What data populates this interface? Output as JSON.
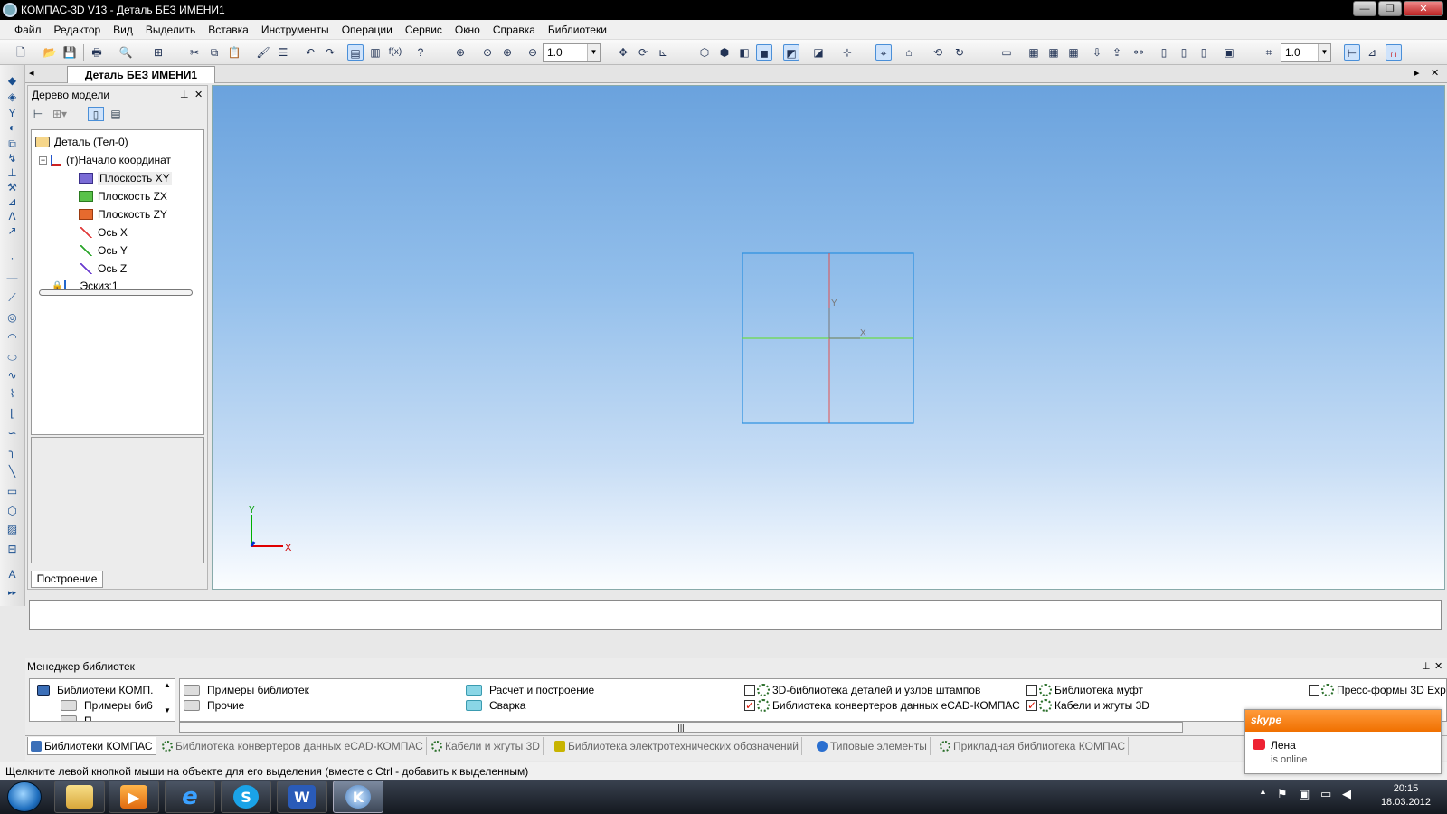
{
  "window": {
    "title": "КОМПАС-3D V13 - Деталь БЕЗ ИМЕНИ1",
    "minimize_icon": "minimize-icon",
    "maximize_icon": "restore-icon",
    "close_icon": "close-icon"
  },
  "menu": [
    "Файл",
    "Редактор",
    "Вид",
    "Выделить",
    "Вставка",
    "Инструменты",
    "Операции",
    "Сервис",
    "Окно",
    "Справка",
    "Библиотеки"
  ],
  "toolbar": {
    "zoom_value": "1.0",
    "step_value": "1.0"
  },
  "document_tab": "Деталь БЕЗ ИМЕНИ1",
  "model_tree": {
    "title": "Дерево модели",
    "items": [
      {
        "label": "Деталь (Тел-0)",
        "icon": "part-icon"
      },
      {
        "label": "(т)Начало координат",
        "icon": "origin-icon"
      },
      {
        "label": "Плоскость XY",
        "icon": "plane-xy-icon"
      },
      {
        "label": "Плоскость ZX",
        "icon": "plane-zx-icon"
      },
      {
        "label": "Плоскость ZY",
        "icon": "plane-zy-icon"
      },
      {
        "label": "Ось X",
        "icon": "axis-x-icon"
      },
      {
        "label": "Ось Y",
        "icon": "axis-y-icon"
      },
      {
        "label": "Ось Z",
        "icon": "axis-z-icon"
      },
      {
        "label": "Эскиз:1",
        "icon": "sketch-icon"
      }
    ],
    "tab_label": "Построение"
  },
  "viewport": {
    "sketch_axis_x": "X",
    "sketch_axis_y": "Y",
    "triad_x": "X",
    "triad_y": "Y",
    "colors": {
      "plane_border": "#2a8fe0",
      "axis_red": "#e05050",
      "axis_green": "#6cd94a",
      "triad_x": "#e00000",
      "triad_y": "#00b000",
      "triad_z": "#0030d0"
    }
  },
  "library_manager": {
    "title": "Менеджер библиотек",
    "left_items": [
      "Библиотеки КОМП.",
      "Примеры би6",
      "П"
    ],
    "items": [
      {
        "label": "Примеры библиотек",
        "icon": "folder-icon"
      },
      {
        "label": "Прочие",
        "icon": "folder-icon"
      },
      {
        "label": "Расчет и построение",
        "icon": "folder-icon"
      },
      {
        "label": "Сварка",
        "icon": "folder-icon"
      },
      {
        "label": "3D-библиотека деталей и узлов штампов",
        "icon": "library-gear-icon",
        "checked": false
      },
      {
        "label": "Библиотека конвертеров данных eCAD-КОМПАС",
        "icon": "library-gear-icon",
        "checked": true
      },
      {
        "label": "Библиотека муфт",
        "icon": "library-gear-icon",
        "checked": false
      },
      {
        "label": "Кабели и жгуты 3D",
        "icon": "library-gear-icon",
        "checked": true
      },
      {
        "label": "Пресс-формы 3D Exp",
        "icon": "library-gear-icon",
        "checked": false
      }
    ],
    "tabs": [
      "Библиотеки КОМПАС",
      "Библиотека конвертеров данных eCAD-КОМПАС",
      "Кабели и жгуты 3D",
      "Библиотека электротехнических обозначений",
      "Типовые элементы",
      "Прикладная библиотека КОМПАС"
    ]
  },
  "status_text": "Щелкните левой кнопкой мыши на объекте для его выделения (вместе с Ctrl - добавить к выделенным)",
  "skype": {
    "brand": "skype",
    "contact_name": "Лена",
    "contact_status": "is online"
  },
  "taskbar": {
    "apps": [
      "explorer-icon",
      "media-player-icon",
      "internet-explorer-icon",
      "skype-icon",
      "word-icon",
      "kompas-icon"
    ],
    "time": "20:15",
    "date": "18.03.2012"
  }
}
